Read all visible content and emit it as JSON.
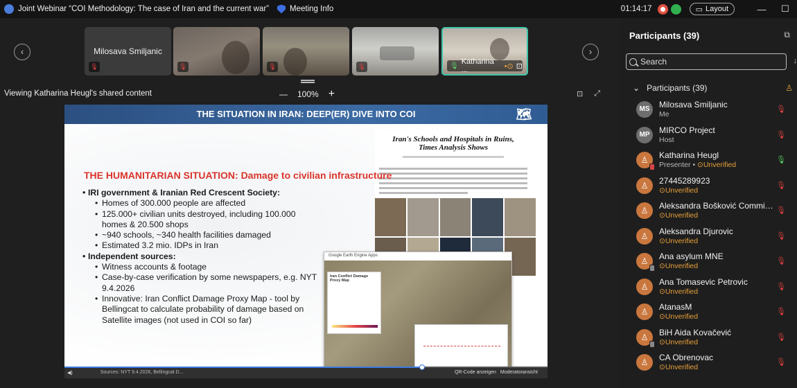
{
  "window": {
    "title": "Joint Webinar “COI Methodology: The case of Iran and the current war”",
    "meeting_info": "Meeting Info",
    "timer": "01:14:17",
    "layout_label": "Layout",
    "minimize": "—",
    "maximize": "☐"
  },
  "icons": {
    "mic_muted": "🎙",
    "prev": "‹",
    "next": "›"
  },
  "strip": {
    "tiles": [
      {
        "name": "Milosava Smiljanic",
        "muted": true
      },
      {
        "name": "",
        "muted": true
      },
      {
        "name": "",
        "muted": true
      },
      {
        "name": "",
        "muted": true
      },
      {
        "name": "Katharina ...",
        "muted": false,
        "active": true
      }
    ]
  },
  "share": {
    "viewing": "Viewing Katharina Heugl's shared content",
    "zoom_out": "—",
    "zoom_level": "100%",
    "zoom_in": "+"
  },
  "slide": {
    "header": "THE SITUATION IN IRAN: DEEP(ER) DIVE INTO COI",
    "subtitle": "THE HUMANITARIAN SITUATION: Damage to civilian infrastructure",
    "bullets": [
      {
        "level": 1,
        "text": "IRI government & Iranian Red Crescent Society:"
      },
      {
        "level": 2,
        "text": "Homes of 300.000 people are affected"
      },
      {
        "level": 2,
        "text": "125.000+ civilian units destroyed, including 100.000"
      },
      {
        "level": 3,
        "text": "homes & 20.500 shops"
      },
      {
        "level": 2,
        "text": "~940 schools, ~340 health facilities damaged"
      },
      {
        "level": 2,
        "text": "Estimated 3.2 mio. IDPs in Iran"
      },
      {
        "level": 1,
        "text": "Independent sources:"
      },
      {
        "level": 2,
        "text": "Witness accounts & footage"
      },
      {
        "level": 2,
        "text": "Case-by-case verification by some newspapers, e.g. NYT"
      },
      {
        "level": 3,
        "text": "9.4.2026"
      },
      {
        "level": 2,
        "text": "Innovative: Iran Conflict Damage Proxy Map - tool by"
      },
      {
        "level": 3,
        "text": "Bellingcat to calculate probability of damage based on"
      },
      {
        "level": 3,
        "text": "Satellite images (not used in COI so far)"
      }
    ],
    "nyt_headline": "Iran's Schools and Hospitals in Ruins, Times Analysis Shows",
    "gee_title": "Google Earth Engine Apps",
    "gee_panel_title": "Iran Conflict Damage Proxy Map",
    "footer_sources": "Sources: NYT 9.4.2026, Bellingcat D...",
    "footer_qr": "QR-Code anzeigen",
    "footer_mod": "Moderatoransicht",
    "progress": 0.74
  },
  "panel": {
    "title": "Participants (39)",
    "search_placeholder": "Search",
    "section_label": "Participants (39)",
    "participants": [
      {
        "initials": "MS",
        "name": "Milosava Smiljanic",
        "sub": "Me",
        "unverified": false,
        "mic": "muted",
        "badge": ""
      },
      {
        "initials": "MP",
        "name": "MIRCO Project",
        "sub": "Host",
        "unverified": false,
        "mic": "muted",
        "badge": ""
      },
      {
        "initials": "",
        "name": "Katharina Heugl",
        "sub": "Presenter •",
        "unverified": true,
        "mic": "on",
        "badge": "red"
      },
      {
        "initials": "",
        "name": "27445289923",
        "sub": "",
        "unverified": true,
        "mic": "muted",
        "badge": ""
      },
      {
        "initials": "",
        "name": "Aleksandra Bošković Commis...",
        "sub": "",
        "unverified": true,
        "mic": "muted",
        "badge": ""
      },
      {
        "initials": "",
        "name": "Aleksandra Djurovic",
        "sub": "",
        "unverified": true,
        "mic": "muted",
        "badge": ""
      },
      {
        "initials": "",
        "name": "Ana asylum MNE",
        "sub": "",
        "unverified": true,
        "mic": "muted",
        "badge": "grey"
      },
      {
        "initials": "",
        "name": "Ana Tomasevic Petrovic",
        "sub": "",
        "unverified": true,
        "mic": "muted",
        "badge": ""
      },
      {
        "initials": "",
        "name": "AtanasM",
        "sub": "",
        "unverified": true,
        "mic": "muted",
        "badge": ""
      },
      {
        "initials": "",
        "name": "BiH Aida Kovačević",
        "sub": "",
        "unverified": true,
        "mic": "muted",
        "badge": "grey"
      },
      {
        "initials": "",
        "name": "CA Obrenovac",
        "sub": "",
        "unverified": true,
        "mic": "muted",
        "badge": ""
      }
    ],
    "unverified_label": "Unverified"
  },
  "colors": {
    "accent_teal": "#3ec6a8",
    "unverified": "#e9a13b",
    "muted_red": "#e34040",
    "slide_header": "#2b4f80",
    "slide_subtitle": "#d9342b"
  }
}
